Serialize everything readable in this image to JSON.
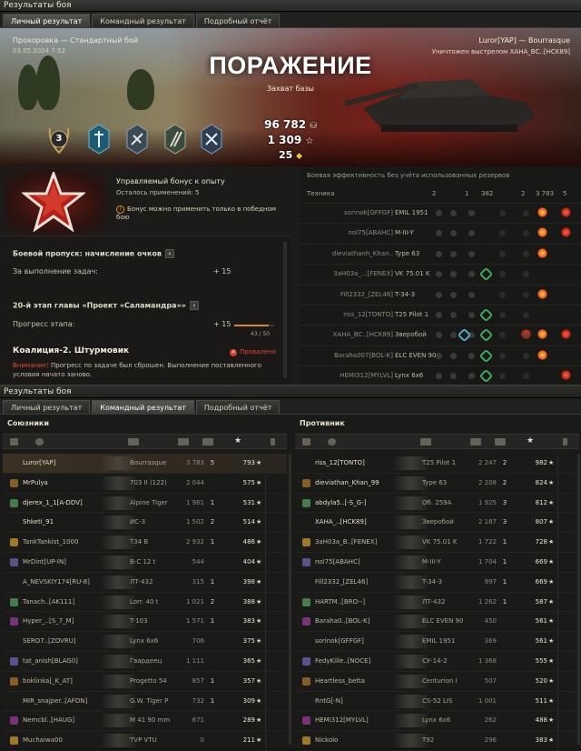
{
  "window_title": "Результаты боя",
  "tabs": [
    "Личный результат",
    "Командный результат",
    "Подробный отчёт"
  ],
  "hero": {
    "map_mode": "Прохоровка — Стандартный бой",
    "datetime": "03.05.2024 7:52",
    "player_tank": "Luror[YAP] — Bourrasque",
    "killed_by": "Уничтожен выстрелом ХАНА_ВС..[HCK89]",
    "result": "ПОРАЖЕНИЕ",
    "mode": "Захват базы",
    "class_mark": "3",
    "credits": "96 782",
    "xp": "1 309",
    "free": "25"
  },
  "bonus": {
    "title": "Управляемый бонус к опыту",
    "uses": "Осталось применений: 5",
    "warning": "Бонус можно применить только в победном бою"
  },
  "battlepass": {
    "title": "Боевой пропуск: начисление очков",
    "task_label": "За выполнение задач:",
    "task_value": "+ 15",
    "stage_title": "20-й этап главы «Проект «Саламандра»»",
    "progress_label": "Прогресс этапа:",
    "progress_value": "+ 15",
    "progress_count": "43 / 50",
    "progress_fraction": 0.86,
    "coalition": "Коалиция-2. Штурмовик",
    "failed": "Провалено",
    "attention_label": "Внимание!",
    "attention_text": "Прогресс по задаче был сброшен. Выполнение поставленного условия начато заново."
  },
  "efficiency": {
    "title": "Боевая эффективность без учёта использованных резервов",
    "col_vehicle": "Техника",
    "cols": [
      "2",
      "",
      "1",
      "382",
      "",
      "2",
      "3 783",
      "5"
    ],
    "rows": [
      {
        "player": "sorinok[GFFGF]",
        "tank": "EMIL 1951",
        "icons": [
          "o",
          "r"
        ]
      },
      {
        "player": "nol75[ABAHC]",
        "tank": "M-III-Y",
        "icons": [
          "o",
          "r"
        ]
      },
      {
        "player": "dieviathanh_Khan..",
        "tank": "Type 63",
        "icons": [
          "o"
        ]
      },
      {
        "player": "3aH03a_...[FENEX]",
        "tank": "VK 75.01 K",
        "icons": [
          "g"
        ]
      },
      {
        "player": "Fill2332_[ZEL46]",
        "tank": "T-34-3",
        "icons": [
          "o"
        ]
      },
      {
        "player": "riss_12[TONTO]",
        "tank": "T25 Pilot 1",
        "icons": [
          "g"
        ]
      },
      {
        "player": "ХАНА_ВС..[HCK89]",
        "tank": "Зверобой",
        "icons": [
          "b",
          "g",
          "r",
          "o",
          "r"
        ]
      },
      {
        "player": "Baraha007[BOL-K]",
        "tank": "ELC EVEN 90",
        "icons": [
          "g",
          "o"
        ]
      },
      {
        "player": "HEMI312[MYLVL]",
        "tank": "Lynx 6x6",
        "icons": [
          "g",
          "r"
        ]
      }
    ]
  },
  "team_tab": {
    "window_title": "Результаты боя",
    "tabs": [
      "Личный результат",
      "Командный результат",
      "Подробный отчёт"
    ],
    "allies_label": "Союзники",
    "enemies_label": "Противник",
    "allies": [
      {
        "player": "Luror[YAP]",
        "tank": "Bourrasque",
        "dmg": "3 783",
        "kills": "5",
        "xp": "793",
        "me": true
      },
      {
        "player": "MrPulya",
        "tank": "703 II (122)",
        "dmg": "2 044",
        "kills": "",
        "xp": "575"
      },
      {
        "player": "djerex_1_1[A-DDV]",
        "tank": "Alpine Tiger",
        "dmg": "1 961",
        "kills": "1",
        "xp": "531"
      },
      {
        "player": "Shketi_91",
        "tank": "ИС-3",
        "dmg": "1 502",
        "kills": "2",
        "xp": "514"
      },
      {
        "player": "TankTankist_1000",
        "tank": "T34 B",
        "dmg": "2 932",
        "kills": "1",
        "xp": "486"
      },
      {
        "player": "MrDint[UP-IN]",
        "tank": "В-С 12 t",
        "dmg": "544",
        "kills": "",
        "xp": "404"
      },
      {
        "player": "A_NEVSKIY174[RU-8]",
        "tank": "ЛТ-432",
        "dmg": "315",
        "kills": "1",
        "xp": "398"
      },
      {
        "player": "Tanach..[AK111]",
        "tank": "Lorr. 40 t",
        "dmg": "1 021",
        "kills": "2",
        "xp": "388"
      },
      {
        "player": "Hyper_..[S_7_M]",
        "tank": "T-103",
        "dmg": "1 571",
        "kills": "1",
        "xp": "383"
      },
      {
        "player": "SERO7..[ZOVRU]",
        "tank": "Lynx 6x6",
        "dmg": "706",
        "kills": "",
        "xp": "375"
      },
      {
        "player": "tat_anish[BLAG0]",
        "tank": "Гвардеец",
        "dmg": "1 111",
        "kills": "",
        "xp": "365"
      },
      {
        "player": "boklinka[_K_AT]",
        "tank": "Progetto 54",
        "dmg": "857",
        "kills": "1",
        "xp": "357"
      },
      {
        "player": "MIR_snajper..[AFON]",
        "tank": "G.W. Tiger P",
        "dmg": "732",
        "kills": "1",
        "xp": "309"
      },
      {
        "player": "Nemcbl..[HAUG]",
        "tank": "M 41 90 mm",
        "dmg": "671",
        "kills": "",
        "xp": "289"
      },
      {
        "player": "Muchaiwa00",
        "tank": "TVP VTU",
        "dmg": "0",
        "kills": "",
        "xp": "211"
      }
    ],
    "enemies": [
      {
        "player": "riss_12[TONTO]",
        "tank": "T25 Pilot 1",
        "dmg": "2 247",
        "kills": "2",
        "xp": "982"
      },
      {
        "player": "dieviathan_Khan_99",
        "tank": "Type 63",
        "dmg": "2 208",
        "kills": "2",
        "xp": "824"
      },
      {
        "player": "abdyla5..[-S_G-]",
        "tank": "Об. 259А",
        "dmg": "1 925",
        "kills": "3",
        "xp": "812"
      },
      {
        "player": "ХАНА_..[HCK89]",
        "tank": "Зверобой",
        "dmg": "2 187",
        "kills": "3",
        "xp": "807"
      },
      {
        "player": "3aH03a_B..[FENEX]",
        "tank": "VK 75.01 K",
        "dmg": "1 722",
        "kills": "1",
        "xp": "728"
      },
      {
        "player": "nol75[ABAHC]",
        "tank": "M-III-Y",
        "dmg": "1 704",
        "kills": "1",
        "xp": "669"
      },
      {
        "player": "Fill2332_[ZEL46]",
        "tank": "T-34-3",
        "dmg": "997",
        "kills": "1",
        "xp": "669"
      },
      {
        "player": "HARTM..[BRO--]",
        "tank": "ЛТ-432",
        "dmg": "1 262",
        "kills": "1",
        "xp": "587"
      },
      {
        "player": "Baraha0..[BOL-K]",
        "tank": "ELC EVEN 90",
        "dmg": "450",
        "kills": "",
        "xp": "561"
      },
      {
        "player": "sorinok[GFFGF]",
        "tank": "EMIL 1951",
        "dmg": "369",
        "kills": "",
        "xp": "561"
      },
      {
        "player": "FedyKille..[NOCE]",
        "tank": "СУ-14-2",
        "dmg": "1 368",
        "kills": "",
        "xp": "555"
      },
      {
        "player": "Heartless_betta",
        "tank": "Centurion I",
        "dmg": "507",
        "kills": "",
        "xp": "520"
      },
      {
        "player": "RntG[-N]",
        "tank": "CS-52 LIS",
        "dmg": "1 001",
        "kills": "",
        "xp": "511"
      },
      {
        "player": "HEMI312[MYLVL]",
        "tank": "Lynx 6x6",
        "dmg": "262",
        "kills": "",
        "xp": "488"
      },
      {
        "player": "Nickolo",
        "tank": "T92",
        "dmg": "296",
        "kills": "",
        "xp": "383"
      }
    ]
  },
  "colors": {
    "defeat_red": "#e6432e",
    "accent_orange": "#e38b1f",
    "bg": "#1a1a18"
  }
}
